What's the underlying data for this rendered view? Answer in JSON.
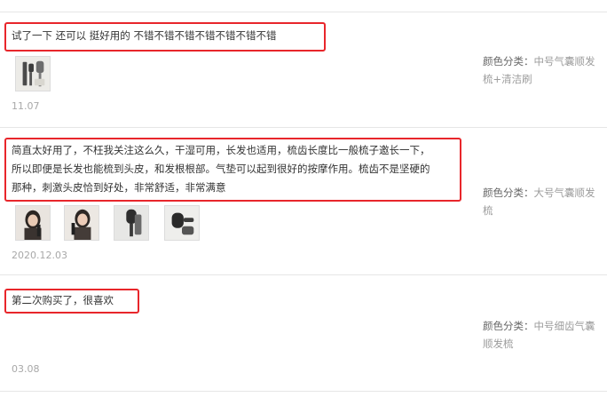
{
  "reviews": [
    {
      "text": "试了一下 还可以 挺好用的 不错不错不错不错不错不错不错",
      "date": "11.07",
      "sku_label": "颜色分类：",
      "sku_value": "中号气囊顺发梳+清洁刷",
      "photos": [
        "product-brush-photo"
      ]
    },
    {
      "text": "简直太好用了，不枉我关注这么久，干湿可用，长发也适用，梳齿长度比一般梳子邀长一下，\n所以即便是长发也能梳到头皮，和发根根部。气垫可以起到很好的按摩作用。梳齿不是坚硬的\n那种，刺激头皮恰到好处，非常舒适，非常满意",
      "date": "2020.12.03",
      "sku_label": "颜色分类：",
      "sku_value": "大号气囊顺发梳",
      "photos": [
        "buyer-photo-1",
        "buyer-photo-2",
        "buyer-photo-3",
        "buyer-photo-4"
      ]
    },
    {
      "text": "第二次购买了，很喜欢",
      "date": "03.08",
      "sku_label": "颜色分类：",
      "sku_value": "中号细齿气囊顺发梳",
      "photos": []
    }
  ],
  "colors": {
    "highlight_border": "#e8262b",
    "text": "#333333",
    "muted": "#9c9c9c",
    "separator": "#e6e6e6"
  }
}
